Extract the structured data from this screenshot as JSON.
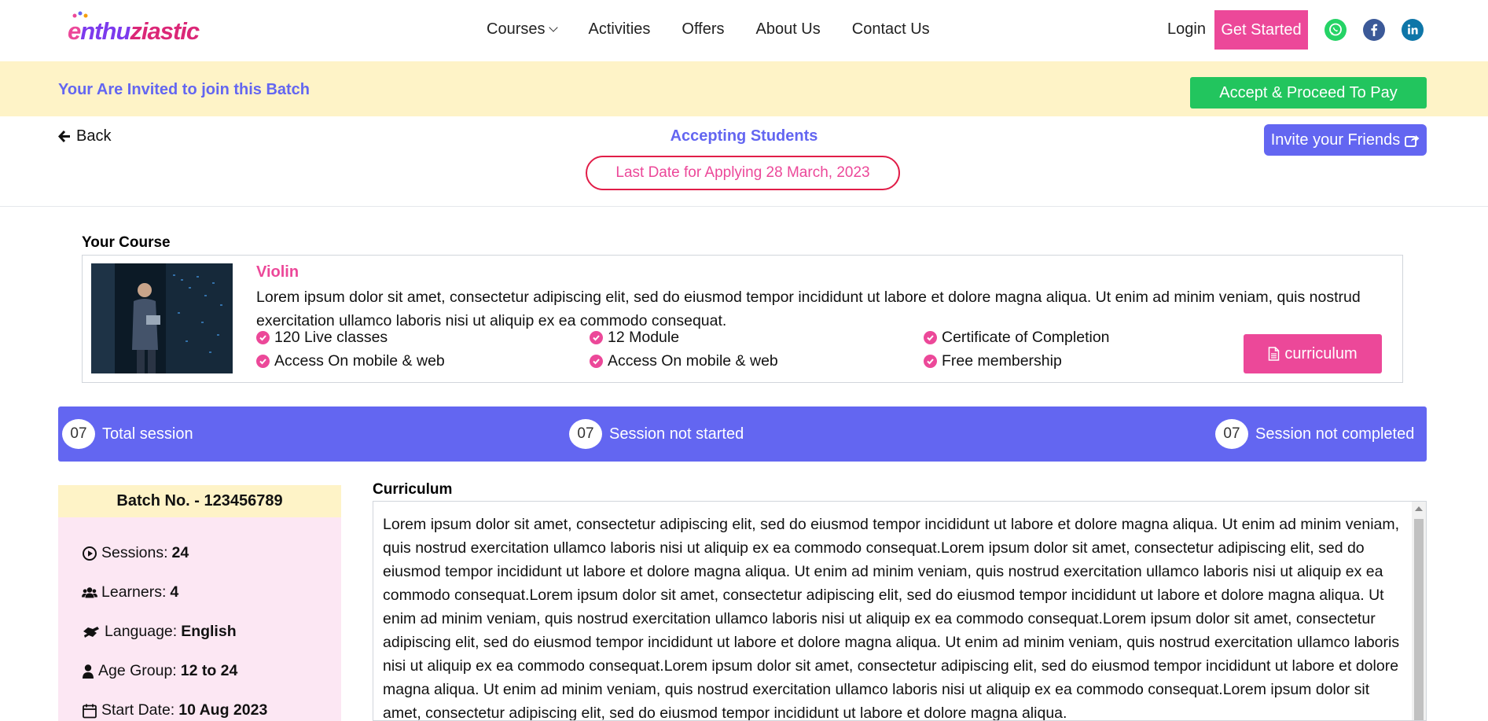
{
  "header": {
    "logo_text": "enthuziastic",
    "nav": [
      {
        "label": "Courses",
        "has_dropdown": true
      },
      {
        "label": "Activities"
      },
      {
        "label": "Offers"
      },
      {
        "label": "About Us"
      },
      {
        "label": "Contact Us"
      }
    ],
    "login_label": "Login",
    "get_started_label": "Get Started",
    "social_icons": [
      "whatsapp-icon",
      "facebook-icon",
      "linkedin-icon"
    ],
    "social_colors": {
      "whatsapp": "#25d366",
      "facebook": "#3b5998",
      "linkedin": "#0e76a8"
    }
  },
  "invite_banner": {
    "text": "Your Are Invited to join this Batch",
    "accept_label": "Accept & Proceed To Pay"
  },
  "status": {
    "back_label": "Back",
    "accepting_label": "Accepting Students",
    "last_date_label": "Last Date for Applying 28 March, 2023",
    "invite_friends_label": "Invite your Friends"
  },
  "course": {
    "section_title": "Your Course",
    "name": "Violin",
    "description": "Lorem ipsum dolor sit amet, consectetur adipiscing elit, sed do eiusmod tempor incididunt ut labore et dolore magna aliqua. Ut enim ad minim veniam, quis nostrud exercitation ullamco laboris nisi ut aliquip ex ea commodo consequat.",
    "features": [
      "120 Live classes",
      "12 Module",
      "Certificate of Completion",
      "Access On mobile & web",
      "Access On mobile & web",
      "Free membership"
    ],
    "curriculum_button": "curriculum"
  },
  "sessions": [
    {
      "count": "07",
      "label": "Total session"
    },
    {
      "count": "07",
      "label": "Session not started"
    },
    {
      "count": "07",
      "label": "Session not completed"
    }
  ],
  "batch": {
    "title": "Batch No. - 123456789",
    "rows": [
      {
        "icon": "play-circle-icon",
        "label": "Sessions: ",
        "value": "24"
      },
      {
        "icon": "users-icon",
        "label": "Learners: ",
        "value": "4"
      },
      {
        "icon": "language-icon",
        "label": "Language: ",
        "value": "English"
      },
      {
        "icon": "user-icon",
        "label": "Age Group:",
        "value": "12 to 24"
      },
      {
        "icon": "calendar-icon",
        "label": "Start Date:",
        "value": "10 Aug 2023"
      }
    ]
  },
  "curriculum": {
    "title": "Curriculum",
    "text": "Lorem ipsum dolor sit amet, consectetur adipiscing elit, sed do eiusmod tempor incididunt ut labore et dolore magna aliqua. Ut enim ad minim veniam, quis nostrud exercitation ullamco laboris nisi ut aliquip ex ea commodo consequat.Lorem ipsum dolor sit amet, consectetur adipiscing elit, sed do eiusmod tempor incididunt ut labore et dolore magna aliqua. Ut enim ad minim veniam, quis nostrud exercitation ullamco laboris nisi ut aliquip ex ea commodo consequat.Lorem ipsum dolor sit amet, consectetur adipiscing elit, sed do eiusmod tempor incididunt ut labore et dolore magna aliqua. Ut enim ad minim veniam, quis nostrud exercitation ullamco laboris nisi ut aliquip ex ea commodo consequat.Lorem ipsum dolor sit amet, consectetur adipiscing elit, sed do eiusmod tempor incididunt ut labore et dolore magna aliqua. Ut enim ad minim veniam, quis nostrud exercitation ullamco laboris nisi ut aliquip ex ea commodo consequat.Lorem ipsum dolor sit amet, consectetur adipiscing elit, sed do eiusmod tempor incididunt ut labore et dolore magna aliqua. Ut enim ad minim veniam, quis nostrud exercitation ullamco laboris nisi ut aliquip ex ea commodo consequat.Lorem ipsum dolor sit amet, consectetur adipiscing elit, sed do eiusmod tempor incididunt ut labore et dolore magna aliqua."
  },
  "colors": {
    "brand_pink": "#ec4899",
    "brand_indigo": "#6366f1",
    "accept_green": "#22c55e",
    "banner_yellow": "#fef3c7",
    "batch_pink": "#fce7f3"
  }
}
